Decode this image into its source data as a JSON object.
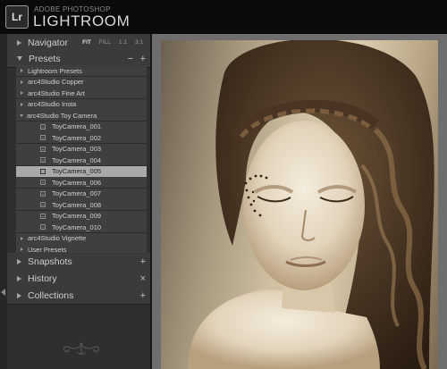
{
  "app": {
    "brand_top": "ADOBE PHOTOSHOP",
    "brand_main": "LIGHTROOM",
    "logo": "Lr"
  },
  "navigator": {
    "title": "Navigator",
    "options": [
      "FIT",
      "FILL",
      "1:1",
      "3:1"
    ],
    "selected": "FIT"
  },
  "presets": {
    "title": "Presets",
    "minus": "−",
    "plus": "+",
    "folders": [
      {
        "label": "Lightroom Presets",
        "expanded": false
      },
      {
        "label": "arc4Studio Copper",
        "expanded": false
      },
      {
        "label": "arc4Studio Fine Art",
        "expanded": false
      },
      {
        "label": "arc4Studio Insta",
        "expanded": false
      },
      {
        "label": "arc4Studio Toy Camera",
        "expanded": true
      }
    ],
    "toy_camera_items": [
      "ToyCamera_001",
      "ToyCamera_002",
      "ToyCamera_003",
      "ToyCamera_004",
      "ToyCamera_005",
      "ToyCamera_006",
      "ToyCamera_007",
      "ToyCamera_008",
      "ToyCamera_009",
      "ToyCamera_010"
    ],
    "selected_item": "ToyCamera_005",
    "after_folders": [
      {
        "label": "arc4Studio Vignette",
        "expanded": false
      },
      {
        "label": "User Presets",
        "expanded": false
      }
    ]
  },
  "snapshots": {
    "title": "Snapshots",
    "action": "+"
  },
  "history": {
    "title": "History",
    "action": "×"
  },
  "collections": {
    "title": "Collections",
    "action": "+"
  },
  "colors": {
    "panel_bg": "#2f2f2f",
    "header_bg": "#3b3b3b",
    "row_bg": "#3f3f3f",
    "selected_row_bg": "#a9a9a9",
    "main_bg": "#6e6e6e",
    "photo_tone": "sepia"
  },
  "icons": [
    "lightroom-logo-icon",
    "collapse-triangle-icon",
    "expand-triangle-icon",
    "preset-icon",
    "ornament-icon",
    "left-panel-toggle-icon"
  ]
}
